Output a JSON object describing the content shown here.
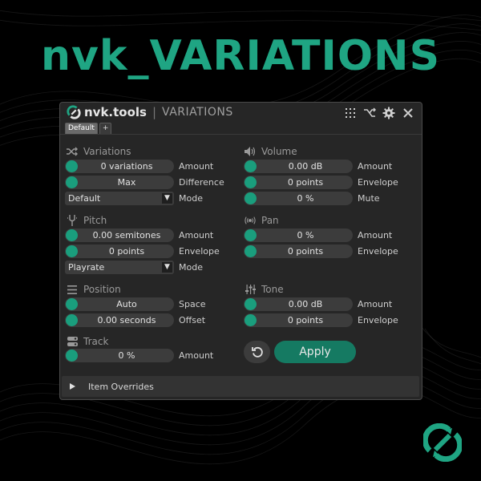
{
  "hero": {
    "title": "nvk_VARIATIONS"
  },
  "window": {
    "brand": "nvk.tools",
    "separator": "|",
    "title": "VARIATIONS",
    "tabs": [
      {
        "label": "Default",
        "active": true
      },
      {
        "label": "+",
        "active": false
      }
    ]
  },
  "sections": {
    "variations": {
      "title": "Variations",
      "rows": [
        {
          "value": "0 variations",
          "label": "Amount"
        },
        {
          "value": "Max",
          "label": "Difference"
        }
      ],
      "select": {
        "value": "Default",
        "label": "Mode"
      }
    },
    "volume": {
      "title": "Volume",
      "rows": [
        {
          "value": "0.00 dB",
          "label": "Amount"
        },
        {
          "value": "0 points",
          "label": "Envelope"
        },
        {
          "value": "0 %",
          "label": "Mute"
        }
      ]
    },
    "pitch": {
      "title": "Pitch",
      "rows": [
        {
          "value": "0.00 semitones",
          "label": "Amount"
        },
        {
          "value": "0 points",
          "label": "Envelope"
        }
      ],
      "select": {
        "value": "Playrate",
        "label": "Mode"
      }
    },
    "pan": {
      "title": "Pan",
      "rows": [
        {
          "value": "0 %",
          "label": "Amount"
        },
        {
          "value": "0 points",
          "label": "Envelope"
        }
      ]
    },
    "position": {
      "title": "Position",
      "rows": [
        {
          "value": "Auto",
          "label": "Space"
        },
        {
          "value": "0.00 seconds",
          "label": "Offset"
        }
      ]
    },
    "tone": {
      "title": "Tone",
      "rows": [
        {
          "value": "0.00 dB",
          "label": "Amount"
        },
        {
          "value": "0 points",
          "label": "Envelope"
        }
      ]
    },
    "track": {
      "title": "Track",
      "rows": [
        {
          "value": "0 %",
          "label": "Amount"
        }
      ]
    }
  },
  "actions": {
    "apply_label": "Apply"
  },
  "overrides": {
    "label": "Item Overrides"
  },
  "colors": {
    "accent": "#1fa583",
    "knob": "#1a9e7d",
    "apply": "#157a62",
    "window_bg": "#262626",
    "field_bg": "#3c3c3c"
  },
  "icons": {
    "variations": "shuffle-icon",
    "volume": "speaker-icon",
    "pitch": "tuning-fork-icon",
    "pan": "broadcast-icon",
    "position": "lines-icon",
    "tone": "sliders-icon",
    "track": "track-icon",
    "reset": "undo-icon"
  }
}
